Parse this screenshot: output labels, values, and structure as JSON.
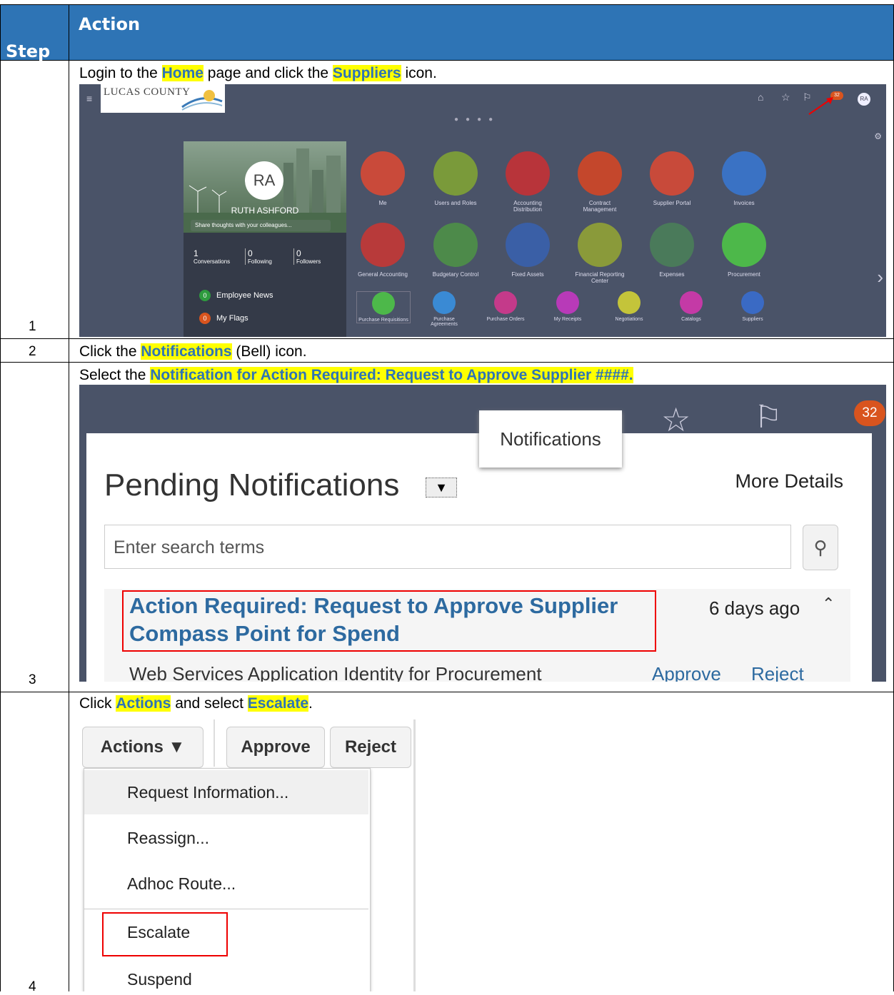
{
  "header": {
    "step_label": "Step",
    "action_label": "Action"
  },
  "rows": [
    {
      "step": "1",
      "pre": "Login to the ",
      "kw1": "Home",
      "mid": " page and click the ",
      "kw2": "Suppliers",
      "post": " icon."
    },
    {
      "step": "2",
      "pre": "Click the ",
      "kw1": "Notifications",
      "post": " (Bell) icon."
    },
    {
      "step": "3",
      "pre": "Select the ",
      "kw1": "Notification for Action Required: Request to Approve Supplier ####."
    },
    {
      "step": "4",
      "pre": "Click ",
      "kw1": "Actions",
      "mid": " and select ",
      "kw2": "Escalate",
      "post": "."
    }
  ],
  "home_screen": {
    "logo": "LUCAS COUNTY",
    "avatar_initials": "RA",
    "bell_count": "32",
    "user_name": "RUTH ASHFORD",
    "share_placeholder": "Share thoughts with your colleagues...",
    "stats": [
      {
        "num": "1",
        "label": "Conversations"
      },
      {
        "num": "0",
        "label": "Following"
      },
      {
        "num": "0",
        "label": "Followers"
      }
    ],
    "links": [
      {
        "count": "0",
        "label": "Employee News",
        "color": "#2e9b3e"
      },
      {
        "count": "0",
        "label": "My Flags",
        "color": "#d9541e"
      }
    ],
    "tiles_row1": [
      {
        "label": "Me",
        "color": "#c94a3a"
      },
      {
        "label": "Users and Roles",
        "color": "#7a9a3a"
      },
      {
        "label": "Accounting Distribution",
        "color": "#b8343a"
      },
      {
        "label": "Contract Management",
        "color": "#c4472c"
      },
      {
        "label": "Supplier Portal",
        "color": "#c84a3a"
      },
      {
        "label": "Invoices",
        "color": "#3a72c4"
      }
    ],
    "tiles_row2": [
      {
        "label": "General Accounting",
        "color": "#b83a3a"
      },
      {
        "label": "Budgetary Control",
        "color": "#4d8a4a"
      },
      {
        "label": "Fixed Assets",
        "color": "#3a5fa6"
      },
      {
        "label": "Financial Reporting Center",
        "color": "#8a9a3a"
      },
      {
        "label": "Expenses",
        "color": "#4a7a5a"
      },
      {
        "label": "Procurement",
        "color": "#4db84a"
      }
    ],
    "tiles_row3": [
      {
        "label": "Purchase Requisitions",
        "color": "#4db84a"
      },
      {
        "label": "Purchase Agreements",
        "color": "#3a8ad4"
      },
      {
        "label": "Purchase Orders",
        "color": "#c43a8a"
      },
      {
        "label": "My Receipts",
        "color": "#b83ab8"
      },
      {
        "label": "Negotiations",
        "color": "#c4c43a"
      },
      {
        "label": "Catalogs",
        "color": "#c43aa6"
      },
      {
        "label": "Suppliers",
        "color": "#3a6ac4"
      }
    ]
  },
  "notif_screen": {
    "tooltip": "Notifications",
    "badge": "32",
    "title": "Pending Notifications",
    "more_details": "More Details",
    "search_placeholder": "Enter search terms",
    "item_title": "Action Required: Request to Approve Supplier Compass Point for Spend",
    "item_age": "6 days ago",
    "item_from": "Web Services Application Identity for Procurement",
    "approve": "Approve",
    "reject": "Reject"
  },
  "actions_screen": {
    "actions": "Actions ▼",
    "approve": "Approve",
    "reject": "Reject",
    "menu": [
      "Request Information...",
      "Reassign...",
      "Adhoc Route...",
      "Escalate",
      "Suspend"
    ]
  }
}
